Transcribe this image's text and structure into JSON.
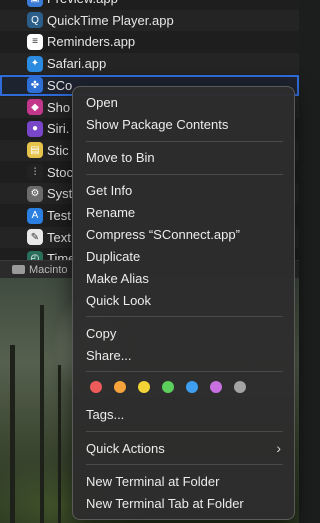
{
  "finder": {
    "files": [
      {
        "name": "Preview.app",
        "icon": "preview-icon",
        "color": "#3a7bd5",
        "glyph": "▣"
      },
      {
        "name": "QuickTime Player.app",
        "icon": "quicktime-icon",
        "color": "#2b5f8a",
        "glyph": "Q"
      },
      {
        "name": "Reminders.app",
        "icon": "reminders-icon",
        "color": "#ffffff",
        "glyph": "≡"
      },
      {
        "name": "Safari.app",
        "icon": "safari-icon",
        "color": "#2a8be0",
        "glyph": "✦"
      },
      {
        "name": "SCo",
        "icon": "sconnect-icon",
        "color": "#2e6fd6",
        "glyph": "✤"
      },
      {
        "name": "Sho",
        "icon": "shortcuts-icon",
        "color": "#c3378a",
        "glyph": "◆"
      },
      {
        "name": "Siri.",
        "icon": "siri-icon",
        "color": "#7a46c9",
        "glyph": "●"
      },
      {
        "name": "Stic",
        "icon": "stickies-icon",
        "color": "#e6c34a",
        "glyph": "▤"
      },
      {
        "name": "Stoc",
        "icon": "stocks-icon",
        "color": "#222222",
        "glyph": "⫶"
      },
      {
        "name": "Syst",
        "icon": "system-preferences-icon",
        "color": "#6b6b6b",
        "glyph": "⚙"
      },
      {
        "name": "Test",
        "icon": "testflight-icon",
        "color": "#2a7fe0",
        "glyph": "A"
      },
      {
        "name": "Text",
        "icon": "textedit-icon",
        "color": "#e9e9e9",
        "glyph": "✎"
      },
      {
        "name": "Time",
        "icon": "time-machine-icon",
        "color": "#2a6e5c",
        "glyph": "◴"
      }
    ],
    "path_label": "Macinto"
  },
  "menu": {
    "open": "Open",
    "show_package_contents": "Show Package Contents",
    "move_to_bin": "Move to Bin",
    "get_info": "Get Info",
    "rename": "Rename",
    "compress": "Compress “SConnect.app”",
    "duplicate": "Duplicate",
    "make_alias": "Make Alias",
    "quick_look": "Quick Look",
    "copy": "Copy",
    "share": "Share...",
    "tag_colors": [
      "#ef5b5b",
      "#f5a33a",
      "#f3d336",
      "#5ccf5c",
      "#3f9ef0",
      "#c870e0",
      "#a4a4a4"
    ],
    "tags": "Tags...",
    "quick_actions": "Quick Actions",
    "quick_actions_chevron": "›",
    "new_terminal": "New Terminal at Folder",
    "new_terminal_tab": "New Terminal Tab at Folder"
  }
}
